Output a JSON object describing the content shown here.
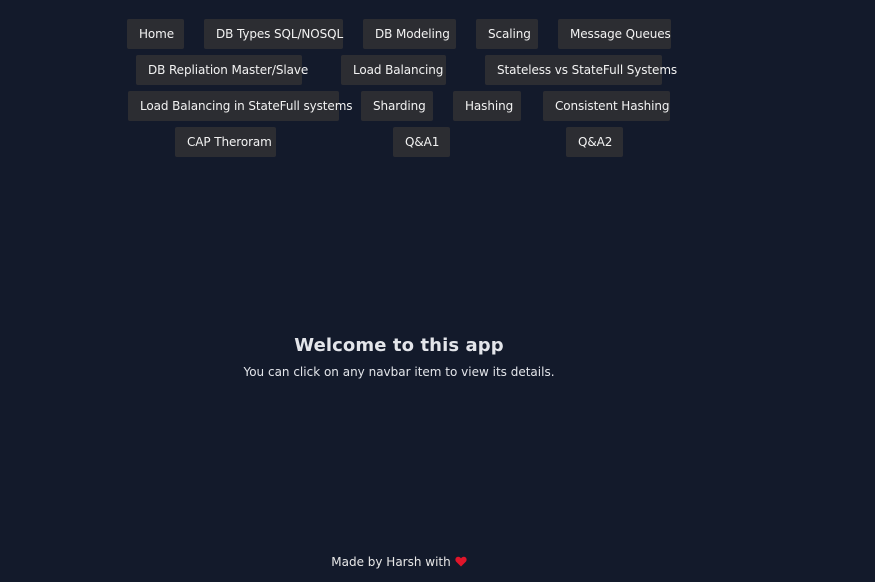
{
  "navbar": {
    "items": [
      {
        "label": "Home"
      },
      {
        "label": "DB Types SQL/NOSQL"
      },
      {
        "label": "DB Modeling"
      },
      {
        "label": "Scaling"
      },
      {
        "label": "Message Queues"
      },
      {
        "label": "DB Repliation Master/Slave"
      },
      {
        "label": "Load Balancing"
      },
      {
        "label": "Stateless vs StateFull Systems"
      },
      {
        "label": "Load Balancing in StateFull systems"
      },
      {
        "label": "Sharding"
      },
      {
        "label": "Hashing"
      },
      {
        "label": "Consistent Hashing"
      },
      {
        "label": "CAP Theroram"
      },
      {
        "label": "Q&A1"
      },
      {
        "label": "Q&A2"
      }
    ]
  },
  "main": {
    "title": "Welcome to this app",
    "subtitle": "You can click on any navbar item to view its details."
  },
  "footer": {
    "text": "Made by Harsh with",
    "heart_icon": "heart-icon",
    "heart_color": "#e0152a"
  },
  "colors": {
    "background": "#131a2b",
    "button_bg": "#2c2d32"
  }
}
